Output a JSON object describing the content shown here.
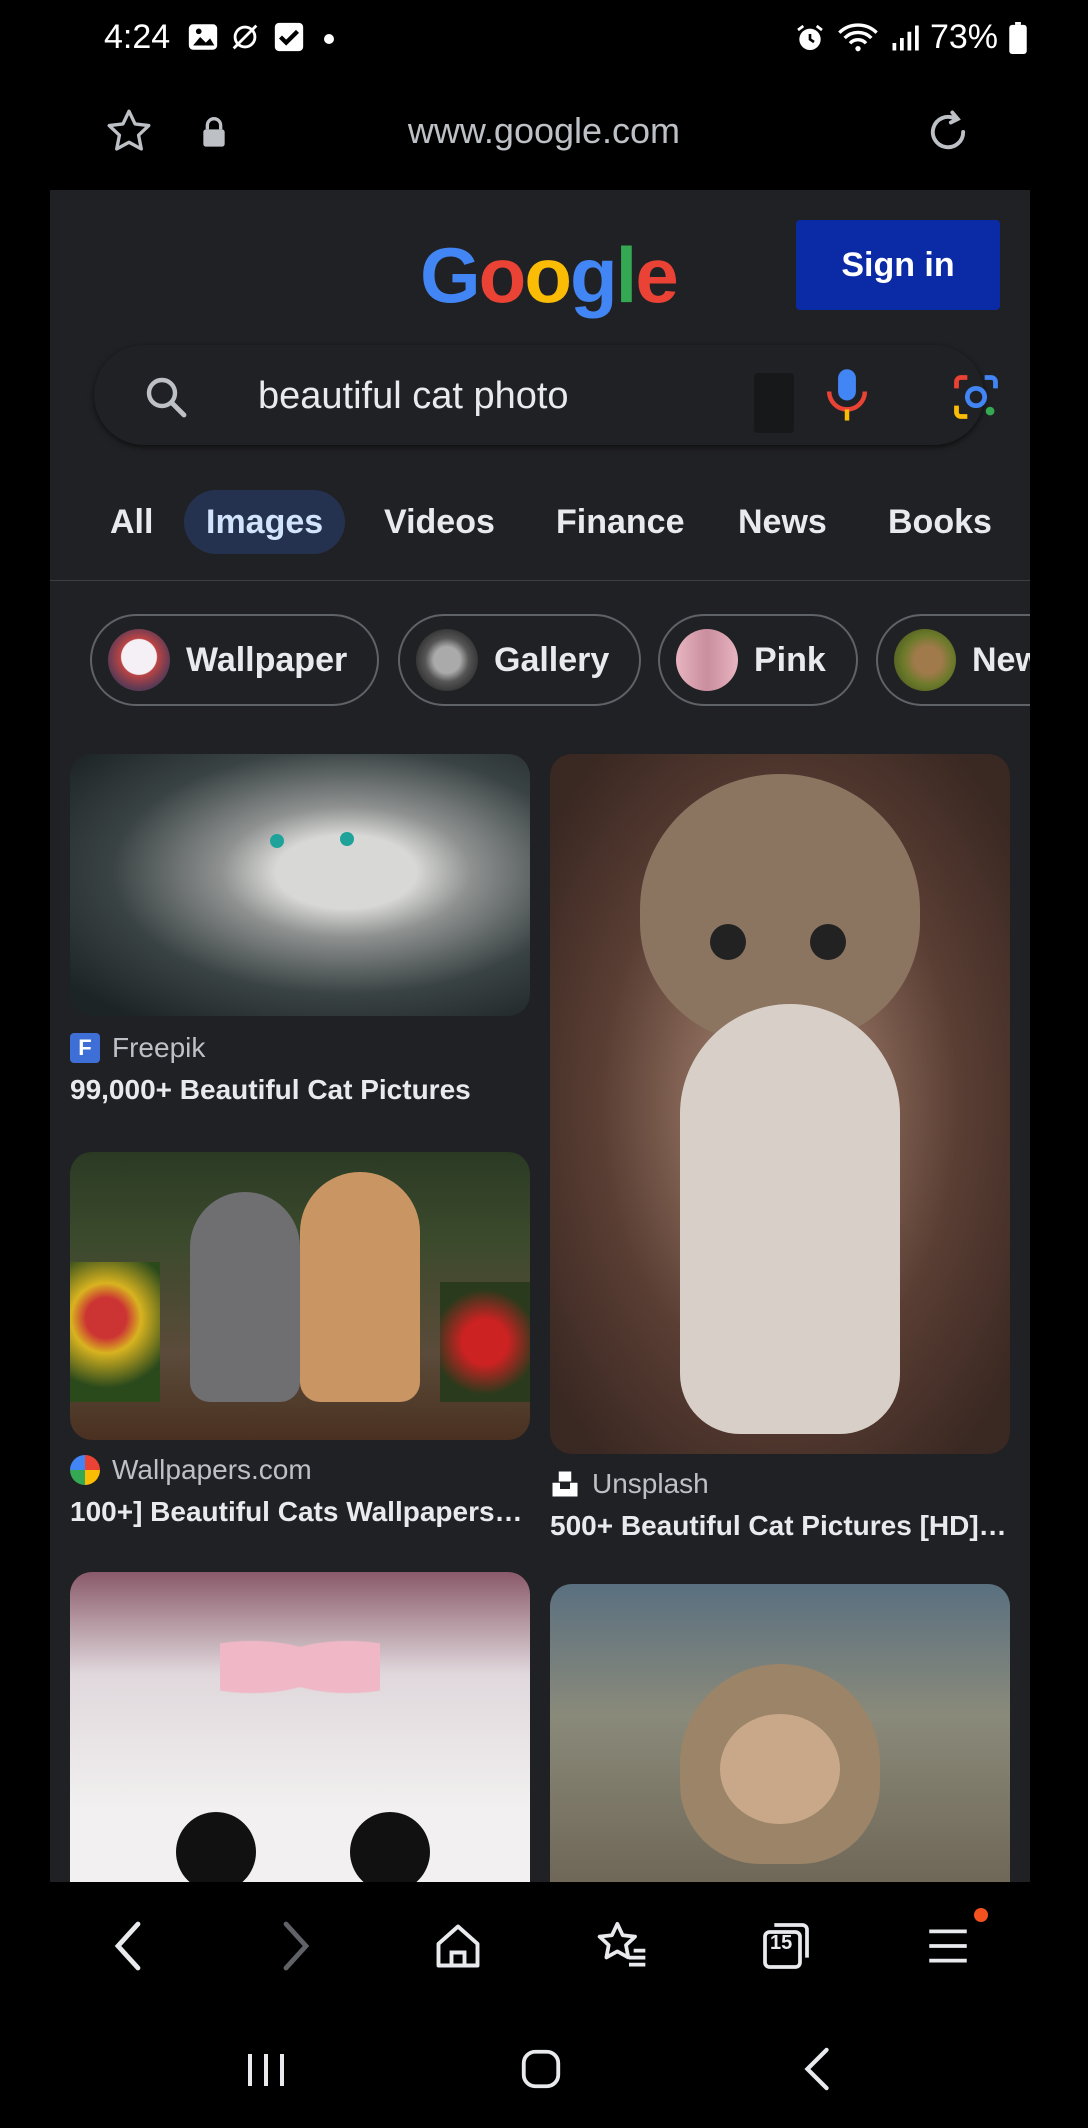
{
  "status_bar": {
    "time": "4:24",
    "battery": "73%",
    "icons_left": [
      "gallery-icon",
      "alarm-off-icon",
      "checkbox-icon",
      "dot-icon"
    ],
    "icons_right": [
      "alarm-icon",
      "wifi-icon",
      "signal-icon",
      "battery-icon"
    ]
  },
  "browser": {
    "url": "www.google.com",
    "tab_count": "15"
  },
  "google": {
    "logo": [
      "G",
      "o",
      "o",
      "g",
      "l",
      "e"
    ],
    "logo_colors": [
      "#4285f4",
      "#ea4335",
      "#fbbc05",
      "#4285f4",
      "#34a853",
      "#ea4335"
    ],
    "sign_in": "Sign in",
    "search_query": "beautiful cat photo"
  },
  "tabs": [
    "All",
    "Images",
    "Videos",
    "Finance",
    "News",
    "Books"
  ],
  "active_tab": "Images",
  "chips": [
    "Wallpaper",
    "Gallery",
    "Pink",
    "New"
  ],
  "results": [
    {
      "source": "Freepik",
      "title": "99,000+ Beautiful Cat Pictures"
    },
    {
      "source": "Wallpapers.com",
      "title": "100+] Beautiful Cats Wallpapers |..."
    },
    {
      "source": "Unsplash",
      "title": "500+ Beautiful Cat Pictures [HD] |..."
    }
  ],
  "colors": {
    "page_bg": "#202124",
    "sign_in_bg": "#0b2aa6",
    "active_tab_bg": "#24324f",
    "notification_dot": "#f4511e"
  }
}
